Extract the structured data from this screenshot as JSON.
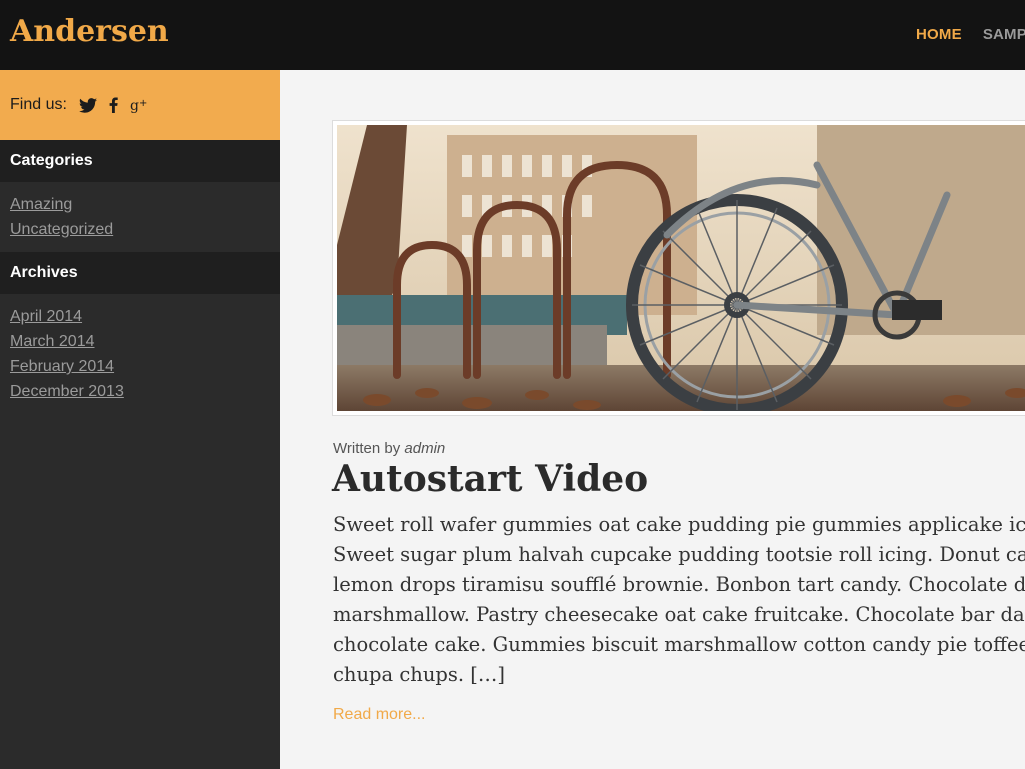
{
  "site": {
    "title": "Andersen"
  },
  "nav": {
    "items": [
      "HOME",
      "SAMPLE"
    ]
  },
  "sidebar": {
    "find_us_label": "Find us:",
    "social_icons": [
      "twitter-icon",
      "facebook-icon",
      "google-plus-icon"
    ],
    "categories_title": "Categories",
    "categories": [
      "Amazing",
      "Uncategorized"
    ],
    "archives_title": "Archives",
    "archives": [
      "April 2014",
      "March 2014",
      "February 2014",
      "December 2013"
    ]
  },
  "post": {
    "written_by": "Written by",
    "author": "admin",
    "title": "Autostart Video",
    "excerpt_lines": [
      "Sweet roll wafer gummies oat cake pudding pie gummies applicake ice",
      "Sweet sugar plum halvah cupcake pudding tootsie roll icing. Donut carro",
      "lemon drops tiramisu soufflé brownie. Bonbon tart candy. Chocolate dan",
      "marshmallow. Pastry cheesecake oat cake fruitcake. Chocolate bar danis",
      "chocolate cake. Gummies biscuit marshmallow cotton candy pie toffee c",
      "chupa chups. […]"
    ],
    "read_more": "Read more..."
  },
  "colors": {
    "accent": "#f1a948",
    "header_bg": "#131313",
    "sidebar_bg": "#2b2b2b"
  }
}
